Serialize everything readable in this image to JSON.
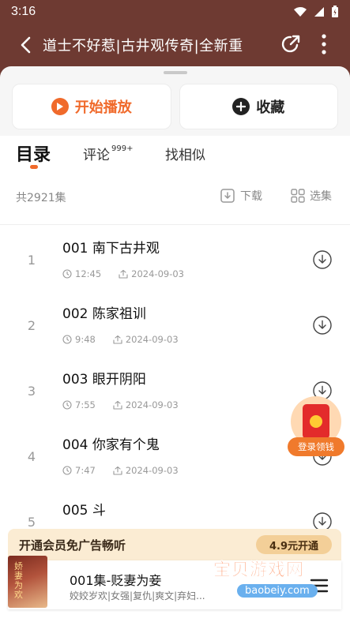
{
  "status_bar": {
    "time": "3:16"
  },
  "header": {
    "title": "道士不好惹|古井观传奇|全新重"
  },
  "actions": {
    "play_label": "开始播放",
    "favorite_label": "收藏"
  },
  "tabs": {
    "catalog": "目录",
    "comments": "评论",
    "comments_badge": "999+",
    "similar": "找相似"
  },
  "list_header": {
    "count": "共2921集",
    "download_label": "下载",
    "select_label": "选集"
  },
  "episodes": [
    {
      "index": "1",
      "title": "001 南下古井观",
      "duration": "12:45",
      "date": "2024-09-03"
    },
    {
      "index": "2",
      "title": "002 陈家祖训",
      "duration": "9:48",
      "date": "2024-09-03"
    },
    {
      "index": "3",
      "title": "003 眼开阴阳",
      "duration": "7:55",
      "date": "2024-09-03"
    },
    {
      "index": "4",
      "title": "004 你家有个鬼",
      "duration": "7:47",
      "date": "2024-09-03"
    },
    {
      "index": "5",
      "title": "005 斗",
      "duration": "",
      "date": ""
    }
  ],
  "reward": {
    "label": "登录领钱"
  },
  "vip_banner": {
    "text": "开通会员免广告畅听",
    "button": "4.9元开通"
  },
  "player": {
    "cover_text": "娇妻为欢",
    "title": "001集-贬妻为妾",
    "tags": "姣姣岁欢|女强|复仇|爽文|弃妇..."
  },
  "watermark": {
    "text": "宝贝游戏网",
    "url": "baobeiy.com"
  },
  "colors": {
    "header_bg": "#6e3a32",
    "accent": "#f06a2b"
  }
}
